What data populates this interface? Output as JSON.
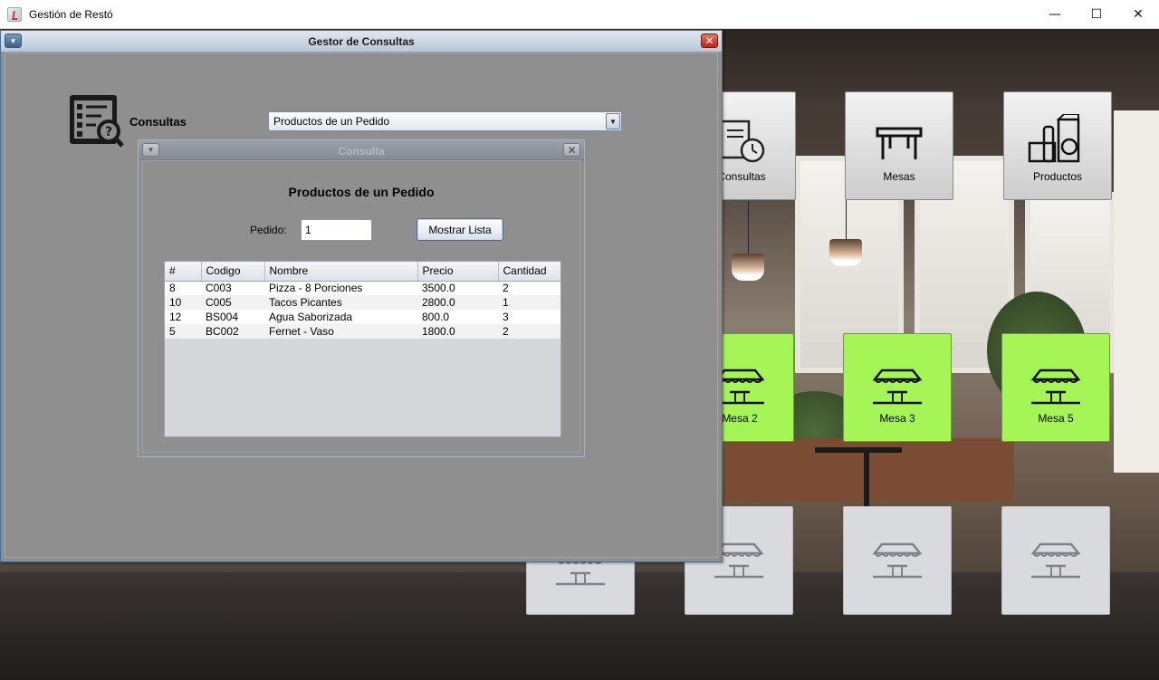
{
  "window": {
    "title": "Gestión de Restó",
    "controls": {
      "minimize": "—",
      "maximize": "☐",
      "close": "✕"
    }
  },
  "menu_tiles": [
    {
      "label": "Consultas",
      "icon": "document-clock-icon"
    },
    {
      "label": "Mesas",
      "icon": "table-icon"
    },
    {
      "label": "Productos",
      "icon": "groceries-icon"
    }
  ],
  "mesas_active": [
    {
      "label": "Mesa 2",
      "icon": "awning-table-icon"
    },
    {
      "label": "Mesa 3",
      "icon": "awning-table-icon"
    },
    {
      "label": "Mesa 5",
      "icon": "awning-table-icon"
    }
  ],
  "gestor": {
    "title": "Gestor de Consultas",
    "label": "Consultas",
    "icon": "checklist-search-icon",
    "combo": {
      "selected": "Productos de un Pedido"
    }
  },
  "consulta": {
    "title": "Consulta",
    "heading": "Productos de un Pedido",
    "pedido_label": "Pedido:",
    "pedido_value": "1",
    "button": "Mostrar Lista",
    "table": {
      "columns": [
        "#",
        "Codigo",
        "Nombre",
        "Precio",
        "Cantidad"
      ],
      "rows": [
        [
          "8",
          "C003",
          "Pizza - 8 Porciones",
          "3500.0",
          "2"
        ],
        [
          "10",
          "C005",
          "Tacos Picantes",
          "2800.0",
          "1"
        ],
        [
          "12",
          "BS004",
          "Agua Saborizada",
          "800.0",
          "3"
        ],
        [
          "5",
          "BC002",
          "Fernet - Vaso",
          "1800.0",
          "2"
        ]
      ]
    }
  },
  "colors": {
    "mesa_active": "#a6f556",
    "frame_body": "#8f8f8f",
    "close_button": "#c9372a"
  }
}
